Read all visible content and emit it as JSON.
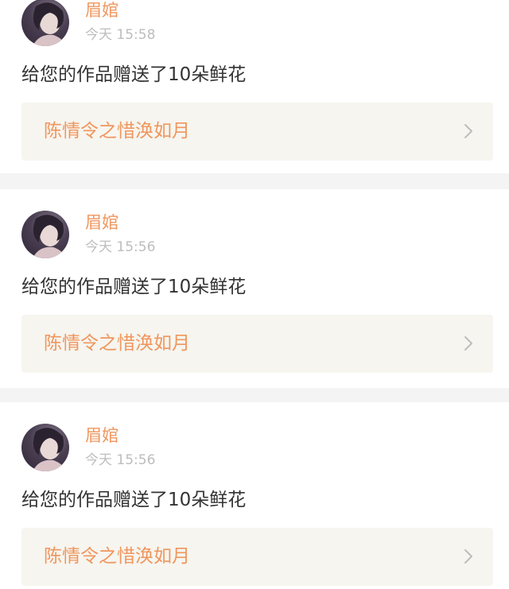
{
  "feed": {
    "items": [
      {
        "username": "眉婠",
        "timestamp": "今天 15:58",
        "message": "给您的作品赠送了10朵鲜花",
        "work_title": "陈情令之惜涣如月",
        "avatar_icon": "user-avatar"
      },
      {
        "username": "眉婠",
        "timestamp": "今天 15:56",
        "message": "给您的作品赠送了10朵鲜花",
        "work_title": "陈情令之惜涣如月",
        "avatar_icon": "user-avatar"
      },
      {
        "username": "眉婠",
        "timestamp": "今天 15:56",
        "message": "给您的作品赠送了10朵鲜花",
        "work_title": "陈情令之惜涣如月",
        "avatar_icon": "user-avatar"
      }
    ]
  },
  "colors": {
    "accent": "#f0965e",
    "timestamp": "#bdbdbd",
    "text": "#333333",
    "link_bg": "#f6f5ef",
    "separator": "#f4f4f4",
    "chevron": "#bdbdbd"
  }
}
